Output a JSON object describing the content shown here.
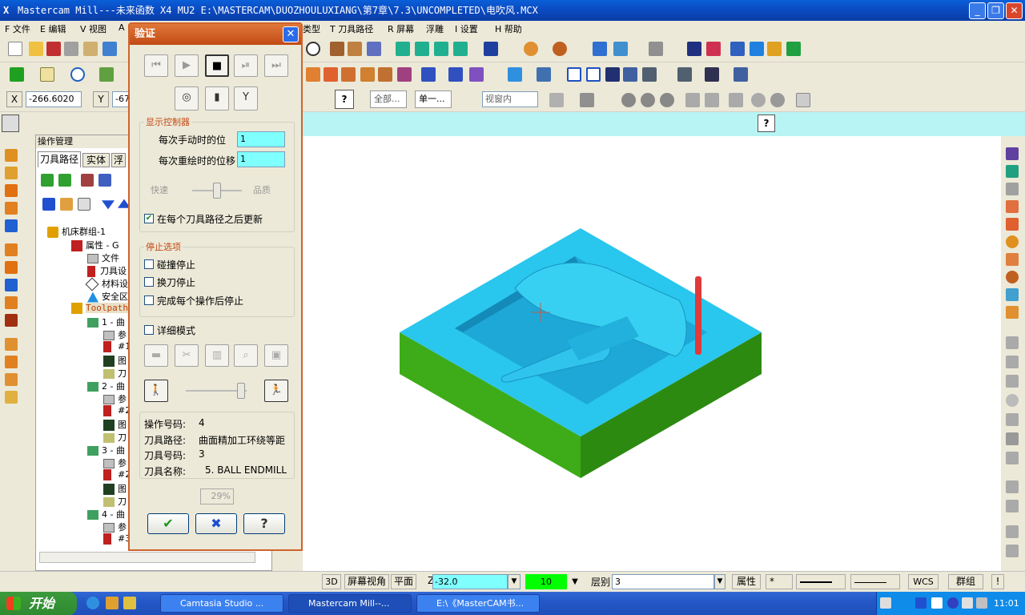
{
  "window": {
    "title": "Mastercam Mill---未来函数 X4 MU2  E:\\MASTERCAM\\DUOZHOULUXIANG\\第7章\\7.3\\UNCOMPLETED\\电吹风.MCX"
  },
  "menu": {
    "items": [
      "F 文件",
      "E 编辑",
      "V 视图",
      "A",
      "类型",
      "T 刀具路径",
      "R 屏幕",
      "浮雕",
      "I 设置",
      "H 帮助"
    ]
  },
  "coords": {
    "x_label": "X",
    "x_value": "-266.6020",
    "y_label": "Y",
    "y_value": "-67"
  },
  "toolbar3": {
    "all_label": "全部...",
    "single_label": "单一...",
    "view_select": "视窗内"
  },
  "left_panel": {
    "title": "操作管理",
    "tabs": [
      "刀具路径",
      "实体",
      "浮"
    ],
    "tree": [
      "机床群组-1",
      "属性 - G",
      "文件",
      "刀具设",
      "材料设",
      "安全区",
      "Toolpath",
      "1 - 曲",
      "参",
      "#1",
      "图",
      "刀",
      "2 - 曲",
      "参",
      "#2",
      "图",
      "刀",
      "3 - 曲",
      "参",
      "#2",
      "图",
      "刀",
      "4 - 曲",
      "参",
      "#3"
    ]
  },
  "dialog": {
    "title": "验证",
    "close_glyph": "✕",
    "display_group": "显示控制器",
    "step_label": "每次手动时的位",
    "step_value": "1",
    "redraw_label": "每次重绘时的位移",
    "redraw_value": "1",
    "speed_label": "快速",
    "quality_label": "品质",
    "update_label": "在每个刀具路径之后更新",
    "update_checked": true,
    "stop_group": "停止选项",
    "stop_collision": "碰撞停止",
    "stop_toolchange": "换刀停止",
    "stop_each_op": "完成每个操作后停止",
    "verbose_label": "详细模式",
    "info": [
      {
        "label": "操作号码:",
        "value": "4"
      },
      {
        "label": "刀具路径:",
        "value": "曲面精加工环绕等距"
      },
      {
        "label": "刀具号码:",
        "value": "3"
      },
      {
        "label": "刀具名称:",
        "value": "5. BALL ENDMILL"
      }
    ],
    "progress": "29%",
    "ok_glyph": "✔",
    "cancel_glyph": "✖",
    "help_glyph": "?"
  },
  "status_bar": {
    "btn_3d": "3D",
    "screen_view": "屏幕视角",
    "plane": "平面",
    "z_label": "Z",
    "z_value": "-32.0",
    "color_value": "10",
    "layer_label": "层别",
    "layer_value": "3",
    "attr": "属性",
    "wcs": "WCS",
    "group": "群组",
    "excl": "!"
  },
  "taskbar": {
    "start": "开始",
    "tasks": [
      "Camtasia Studio ...",
      "Mastercam Mill--...",
      "E:\\《MasterCAM书..."
    ],
    "time": "11:01"
  },
  "colors": {
    "part_top": "#29c6ee",
    "part_side_dark": "#2d8a10",
    "part_side_light": "#3dac18",
    "tool": "#e03a3a",
    "dialog_accent": "#d0632c",
    "field_cyan": "#80ffff"
  }
}
